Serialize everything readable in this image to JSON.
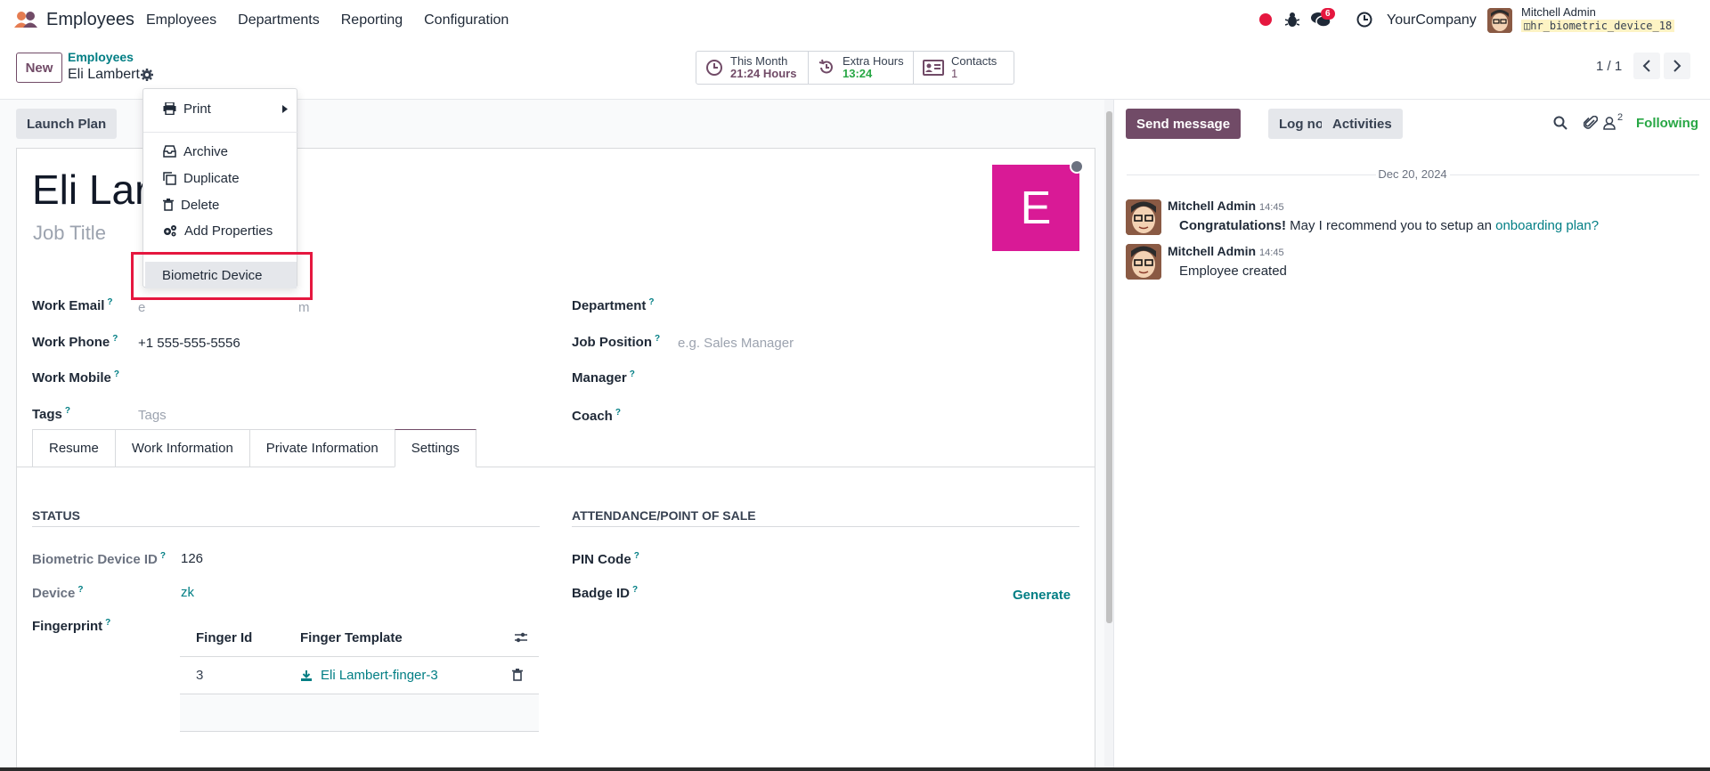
{
  "navbar": {
    "app_name": "Employees",
    "menu": [
      "Employees",
      "Departments",
      "Reporting",
      "Configuration"
    ],
    "chat_badge": "6",
    "company": "YourCompany",
    "user_name": "Mitchell Admin",
    "database": "hr_biometric_device_18"
  },
  "control": {
    "new_label": "New",
    "breadcrumb_parent": "Employees",
    "breadcrumb_current": "Eli Lambert",
    "smart": {
      "this_month_label": "This Month",
      "this_month_value": "21:24 Hours",
      "extra_hours_label": "Extra Hours",
      "extra_hours_value": "13:24",
      "contacts_label": "Contacts",
      "contacts_value": "1"
    },
    "pager": "1 / 1"
  },
  "form": {
    "launch_plan": "Launch Plan",
    "employee_name": "Eli Lambert",
    "employee_name_visible": "Eli Lar",
    "job_title_placeholder": "Job Title",
    "avatar_letter": "E",
    "fields": {
      "work_email_label": "Work Email",
      "work_email_placeholder_tail": "m",
      "work_email_placeholder_head": "e",
      "work_phone_label": "Work Phone",
      "work_phone_value": "+1 555-555-5556",
      "work_mobile_label": "Work Mobile",
      "tags_label": "Tags",
      "tags_placeholder": "Tags",
      "department_label": "Department",
      "job_position_label": "Job Position",
      "job_position_placeholder": "e.g. Sales Manager",
      "manager_label": "Manager",
      "coach_label": "Coach"
    },
    "tabs": [
      "Resume",
      "Work Information",
      "Private Information",
      "Settings"
    ],
    "settings": {
      "status_title": "STATUS",
      "attendance_title": "ATTENDANCE/POINT OF SALE",
      "biometric_id_label": "Biometric Device ID",
      "biometric_id_value": "126",
      "device_label": "Device",
      "device_value": "zk",
      "fingerprint_label": "Fingerprint",
      "pin_label": "PIN Code",
      "badge_label": "Badge ID",
      "generate": "Generate",
      "fp_columns": [
        "Finger Id",
        "Finger Template"
      ],
      "fp_rows": [
        {
          "id": "3",
          "template": "Eli Lambert-finger-3"
        }
      ]
    }
  },
  "dropdown": {
    "print": "Print",
    "archive": "Archive",
    "duplicate": "Duplicate",
    "delete": "Delete",
    "add_properties": "Add Properties",
    "biometric_device": "Biometric Device"
  },
  "chatter": {
    "send_message": "Send message",
    "log_note": "Log note",
    "activities": "Activities",
    "followers_count": "2",
    "following": "Following",
    "date": "Dec 20, 2024",
    "messages": [
      {
        "author": "Mitchell Admin",
        "time": "14:45",
        "strong": "Congratulations!",
        "text": " May I recommend you to setup an ",
        "link": "onboarding plan?"
      },
      {
        "author": "Mitchell Admin",
        "time": "14:45",
        "text": "Employee created"
      }
    ]
  },
  "colors": {
    "brand": "#714b67",
    "link": "#017e84",
    "danger": "#e5173f",
    "avatar": "#d91a96",
    "success": "#28a745"
  },
  "icons": [
    "app-logo-icon",
    "bug-icon",
    "chat-icon",
    "clock-icon",
    "database-icon",
    "gear-icon",
    "history-icon",
    "contact-card-icon",
    "chevron-left-icon",
    "chevron-right-icon",
    "printer-icon",
    "caret-right-icon",
    "archive-icon",
    "duplicate-icon",
    "trash-icon",
    "cogs-icon",
    "download-icon",
    "column-settings-icon",
    "search-icon",
    "paperclip-icon",
    "follower-icon"
  ]
}
